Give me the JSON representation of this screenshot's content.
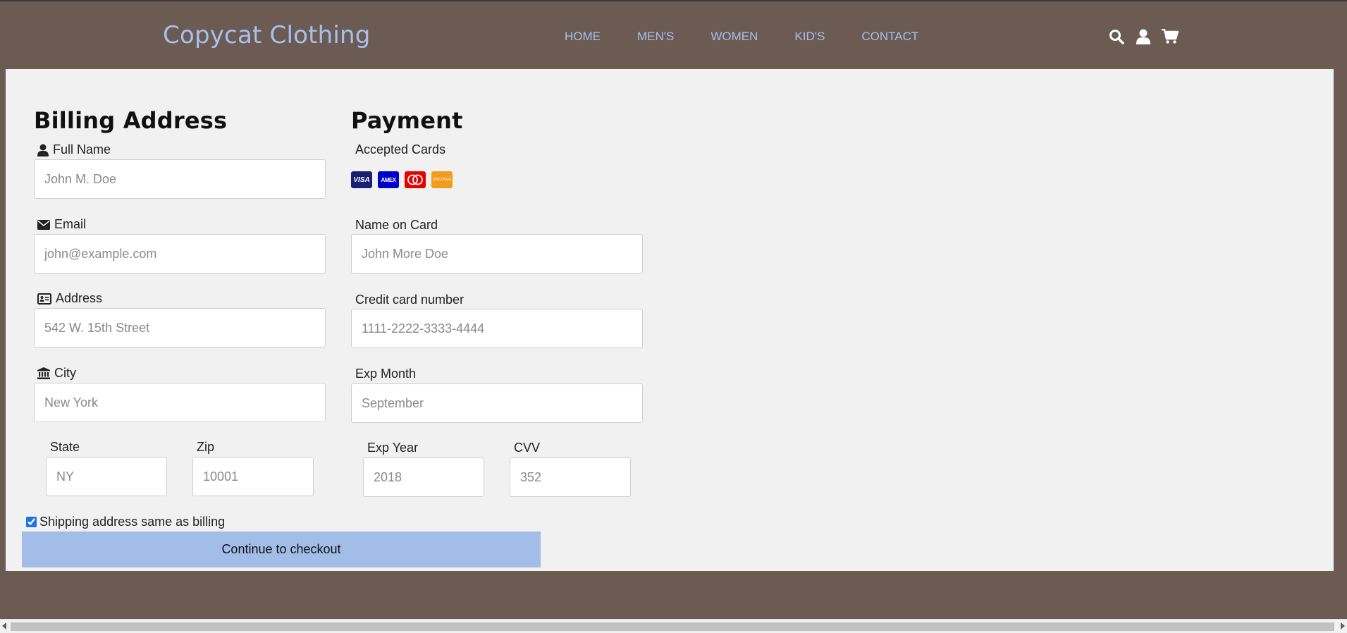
{
  "brand": "Copycat Clothing",
  "nav": {
    "links": [
      "HOME",
      "MEN'S",
      "WOMEN",
      "KID'S",
      "CONTACT"
    ],
    "icons": [
      "search-icon",
      "user-icon",
      "cart-icon"
    ]
  },
  "billing": {
    "heading": "Billing Address",
    "full_name": {
      "label": "Full Name",
      "placeholder": "John M. Doe"
    },
    "email": {
      "label": "Email",
      "placeholder": "john@example.com"
    },
    "address": {
      "label": "Address",
      "placeholder": "542 W. 15th Street"
    },
    "city": {
      "label": "City",
      "placeholder": "New York"
    },
    "state": {
      "label": "State",
      "placeholder": "NY"
    },
    "zip": {
      "label": "Zip",
      "placeholder": "10001"
    }
  },
  "payment": {
    "heading": "Payment",
    "accepted_label": "Accepted Cards",
    "cards": [
      {
        "icon": "visa-icon",
        "text": "VISA",
        "color": "#1a1f71"
      },
      {
        "icon": "amex-icon",
        "text": "AMEX",
        "color": "#0000cc"
      },
      {
        "icon": "mastercard-icon",
        "text": "",
        "color": "#e60000"
      },
      {
        "icon": "discover-icon",
        "text": "DISCOVER",
        "color": "#f29b1d"
      }
    ],
    "name_on_card": {
      "label": "Name on Card",
      "placeholder": "John More Doe"
    },
    "card_number": {
      "label": "Credit card number",
      "placeholder": "1111-2222-3333-4444"
    },
    "exp_month": {
      "label": "Exp Month",
      "placeholder": "September"
    },
    "exp_year": {
      "label": "Exp Year",
      "placeholder": "2018"
    },
    "cvv": {
      "label": "CVV",
      "placeholder": "352"
    }
  },
  "shipping_checkbox": {
    "label": "Shipping address same as billing",
    "checked": true
  },
  "checkout_button": "Continue to checkout",
  "colors": {
    "background": "#6b5b52",
    "brand": "#a9bff0",
    "panel": "#f1f1f1",
    "button": "#a3bde9"
  }
}
